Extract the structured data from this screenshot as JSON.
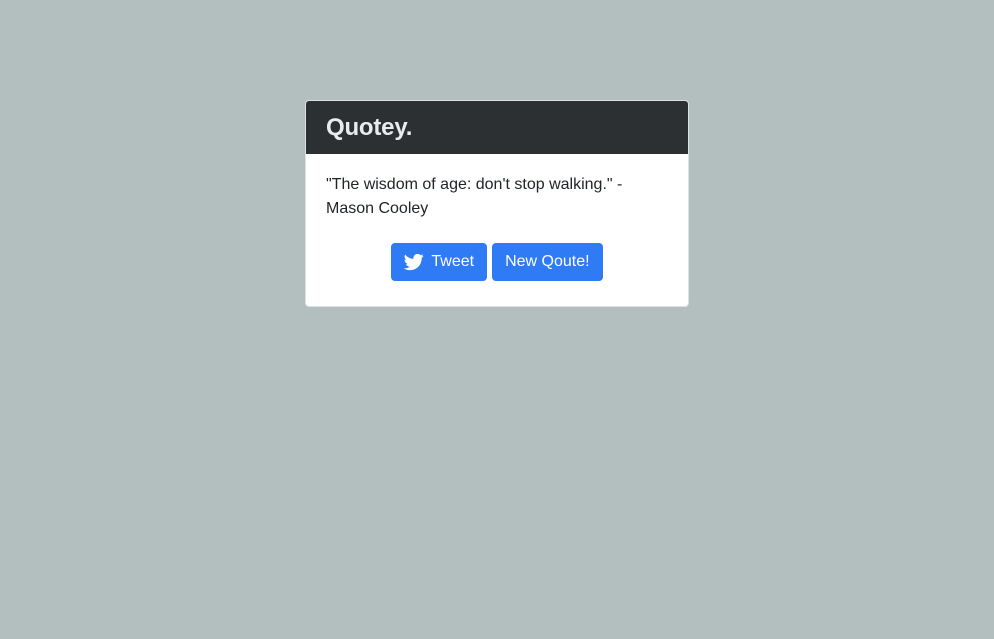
{
  "app": {
    "brand": "Quotey."
  },
  "quote": {
    "text": "\"The wisdom of age: don't stop walking.\" - Mason Cooley"
  },
  "actions": {
    "tweet_label": "Tweet",
    "tweet_icon": "twitter-icon",
    "new_quote_label": "New Qoute!"
  },
  "colors": {
    "page_background": "#b2bfbe",
    "header_background": "#2c3032",
    "button_primary": "#2f7bf5"
  }
}
